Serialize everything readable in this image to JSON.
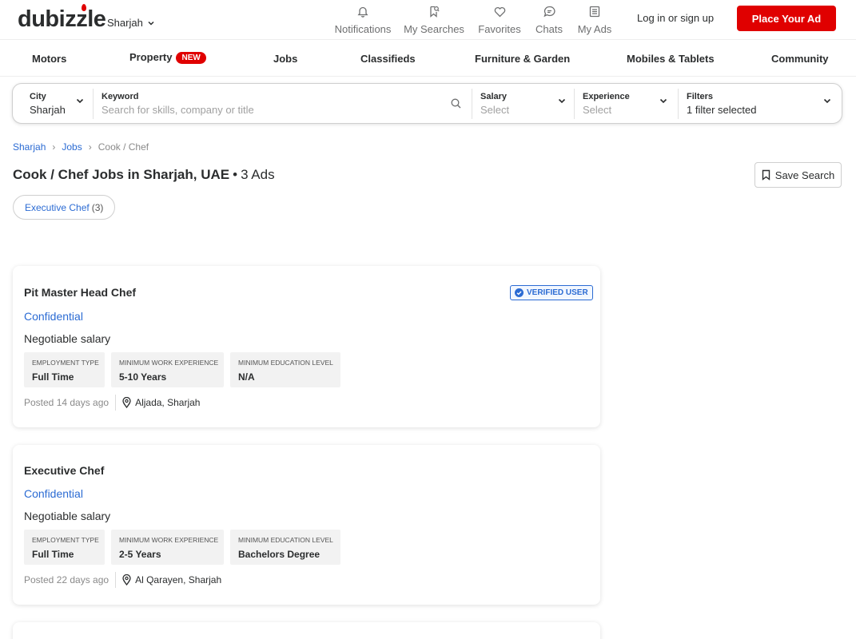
{
  "header": {
    "logo": "dubizzle",
    "city": "Sharjah",
    "nav": [
      {
        "label": "Notifications",
        "icon": "bell-icon"
      },
      {
        "label": "My Searches",
        "icon": "bookmark-search-icon"
      },
      {
        "label": "Favorites",
        "icon": "heart-icon"
      },
      {
        "label": "Chats",
        "icon": "chat-icon"
      },
      {
        "label": "My Ads",
        "icon": "list-icon"
      }
    ],
    "login": "Log in or sign up",
    "place_ad": "Place Your Ad"
  },
  "categories": [
    {
      "label": "Motors"
    },
    {
      "label": "Property",
      "badge": "NEW"
    },
    {
      "label": "Jobs"
    },
    {
      "label": "Classifieds"
    },
    {
      "label": "Furniture & Garden"
    },
    {
      "label": "Mobiles & Tablets"
    },
    {
      "label": "Community"
    }
  ],
  "search": {
    "city": {
      "label": "City",
      "value": "Sharjah"
    },
    "keyword": {
      "label": "Keyword",
      "placeholder": "Search for skills, company or title"
    },
    "salary": {
      "label": "Salary",
      "placeholder": "Select"
    },
    "experience": {
      "label": "Experience",
      "placeholder": "Select"
    },
    "filters": {
      "label": "Filters",
      "value": "1 filter selected"
    }
  },
  "breadcrumb": [
    "Sharjah",
    "Jobs",
    "Cook / Chef"
  ],
  "page": {
    "title": "Cook / Chef Jobs in Sharjah, UAE",
    "separator": "•",
    "count": "3 Ads",
    "save_search": "Save Search",
    "chip": {
      "name": "Executive Chef",
      "count": "(3)"
    }
  },
  "listings": [
    {
      "title": "Pit Master Head Chef",
      "verified": "VERIFIED USER",
      "company": "Confidential",
      "salary": "Negotiable salary",
      "attributes": [
        {
          "key": "Employment Type",
          "value": "Full Time"
        },
        {
          "key": "Minimum Work Experience",
          "value": "5-10 Years"
        },
        {
          "key": "Minimum Education Level",
          "value": "N/A"
        }
      ],
      "posted": "Posted 14 days ago",
      "location": "Aljada, Sharjah"
    },
    {
      "title": "Executive Chef",
      "company": "Confidential",
      "salary": "Negotiable salary",
      "attributes": [
        {
          "key": "Employment Type",
          "value": "Full Time"
        },
        {
          "key": "Minimum Work Experience",
          "value": "2-5 Years"
        },
        {
          "key": "Minimum Education Level",
          "value": "Bachelors Degree"
        }
      ],
      "posted": "Posted 22 days ago",
      "location": "Al Qarayen, Sharjah"
    }
  ],
  "colors": {
    "brand_red": "#e00000",
    "link_blue": "#2b6bd3"
  }
}
